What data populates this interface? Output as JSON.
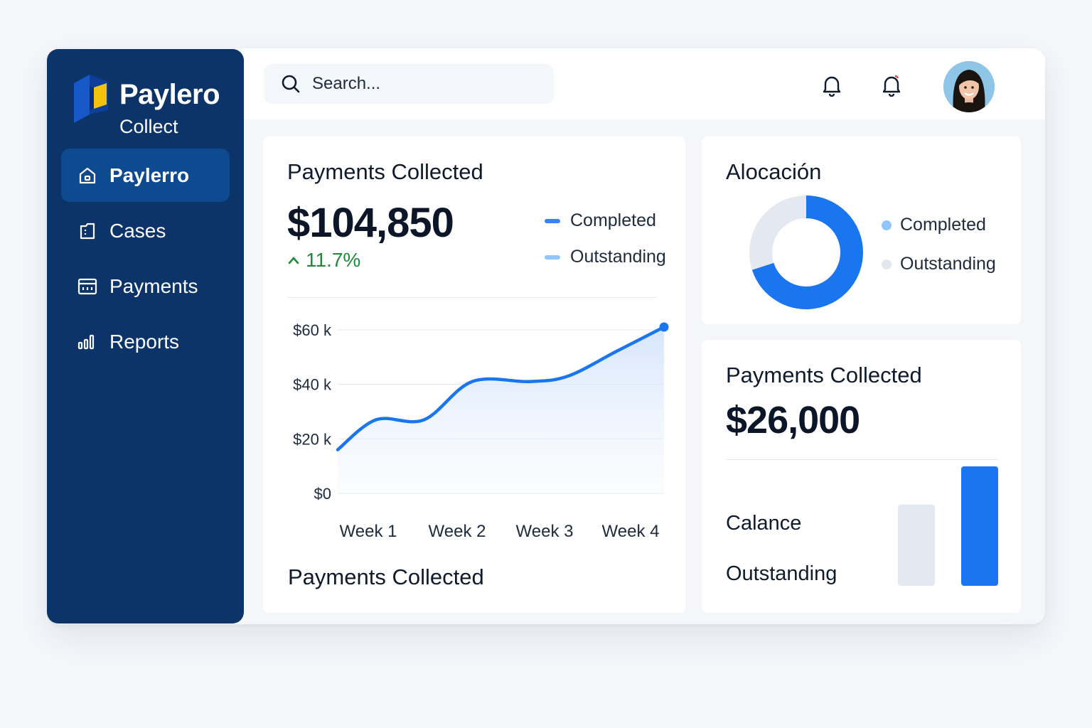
{
  "brand": {
    "name": "Paylero",
    "sub": "Collect"
  },
  "sidebar": {
    "items": [
      {
        "label": "Paylerro",
        "icon": "home-icon",
        "active": true
      },
      {
        "label": "Cases",
        "icon": "folder-icon",
        "active": false
      },
      {
        "label": "Payments",
        "icon": "calendar-icon",
        "active": false
      },
      {
        "label": "Reports",
        "icon": "bar-chart-icon",
        "active": false
      }
    ]
  },
  "header": {
    "search_placeholder": "Search...",
    "icons": [
      "search-icon",
      "bell-icon",
      "bell-notification-icon",
      "avatar"
    ]
  },
  "payments_card": {
    "title": "Payments Collected",
    "total": "$104,850",
    "delta": "11.7%",
    "legend": [
      {
        "label": "Completed",
        "color": "#3b82f6"
      },
      {
        "label": "Outstanding",
        "color": "#93c5fd"
      }
    ],
    "footer_title": "Payments Collected"
  },
  "allocation_card": {
    "title": "Alocación",
    "legend": [
      {
        "label": "Completed",
        "color": "#93c5fd"
      },
      {
        "label": "Outstanding",
        "color": "#e2e8f0"
      }
    ]
  },
  "balance_card": {
    "title": "Payments Collected",
    "total": "$26,000",
    "labels": [
      "Calance",
      "Outstanding"
    ]
  },
  "colors": {
    "sidebar": "#0c3468",
    "accent": "#1a75f0",
    "positive": "#1e8a3a"
  },
  "chart_data": [
    {
      "type": "area",
      "categories": [
        "Week 1",
        "Week 2",
        "Week 3",
        "Week 4"
      ],
      "x": [
        0.6,
        1.0,
        1.5,
        2.0,
        2.6,
        3.0,
        3.5,
        4.0
      ],
      "series": [
        {
          "values": [
            16,
            27,
            27,
            41,
            41,
            43,
            52,
            61
          ]
        }
      ],
      "ytick_labels": [
        "$60 k",
        "$40 k",
        "$20 k",
        "$0"
      ],
      "yticks": [
        60,
        40,
        20,
        0
      ],
      "ylim": [
        0,
        61
      ],
      "grid": true
    },
    {
      "type": "pie",
      "labels": [
        "Completed",
        "Outstanding"
      ],
      "values": [
        70,
        30
      ],
      "colors": [
        "#1a75f0",
        "#e4e9f1"
      ]
    },
    {
      "type": "bar",
      "categories": [
        "Calance",
        "Outstanding"
      ],
      "values": [
        0.68,
        1.0
      ],
      "colors": [
        "#e4e9f1",
        "#1a75f0"
      ]
    }
  ]
}
